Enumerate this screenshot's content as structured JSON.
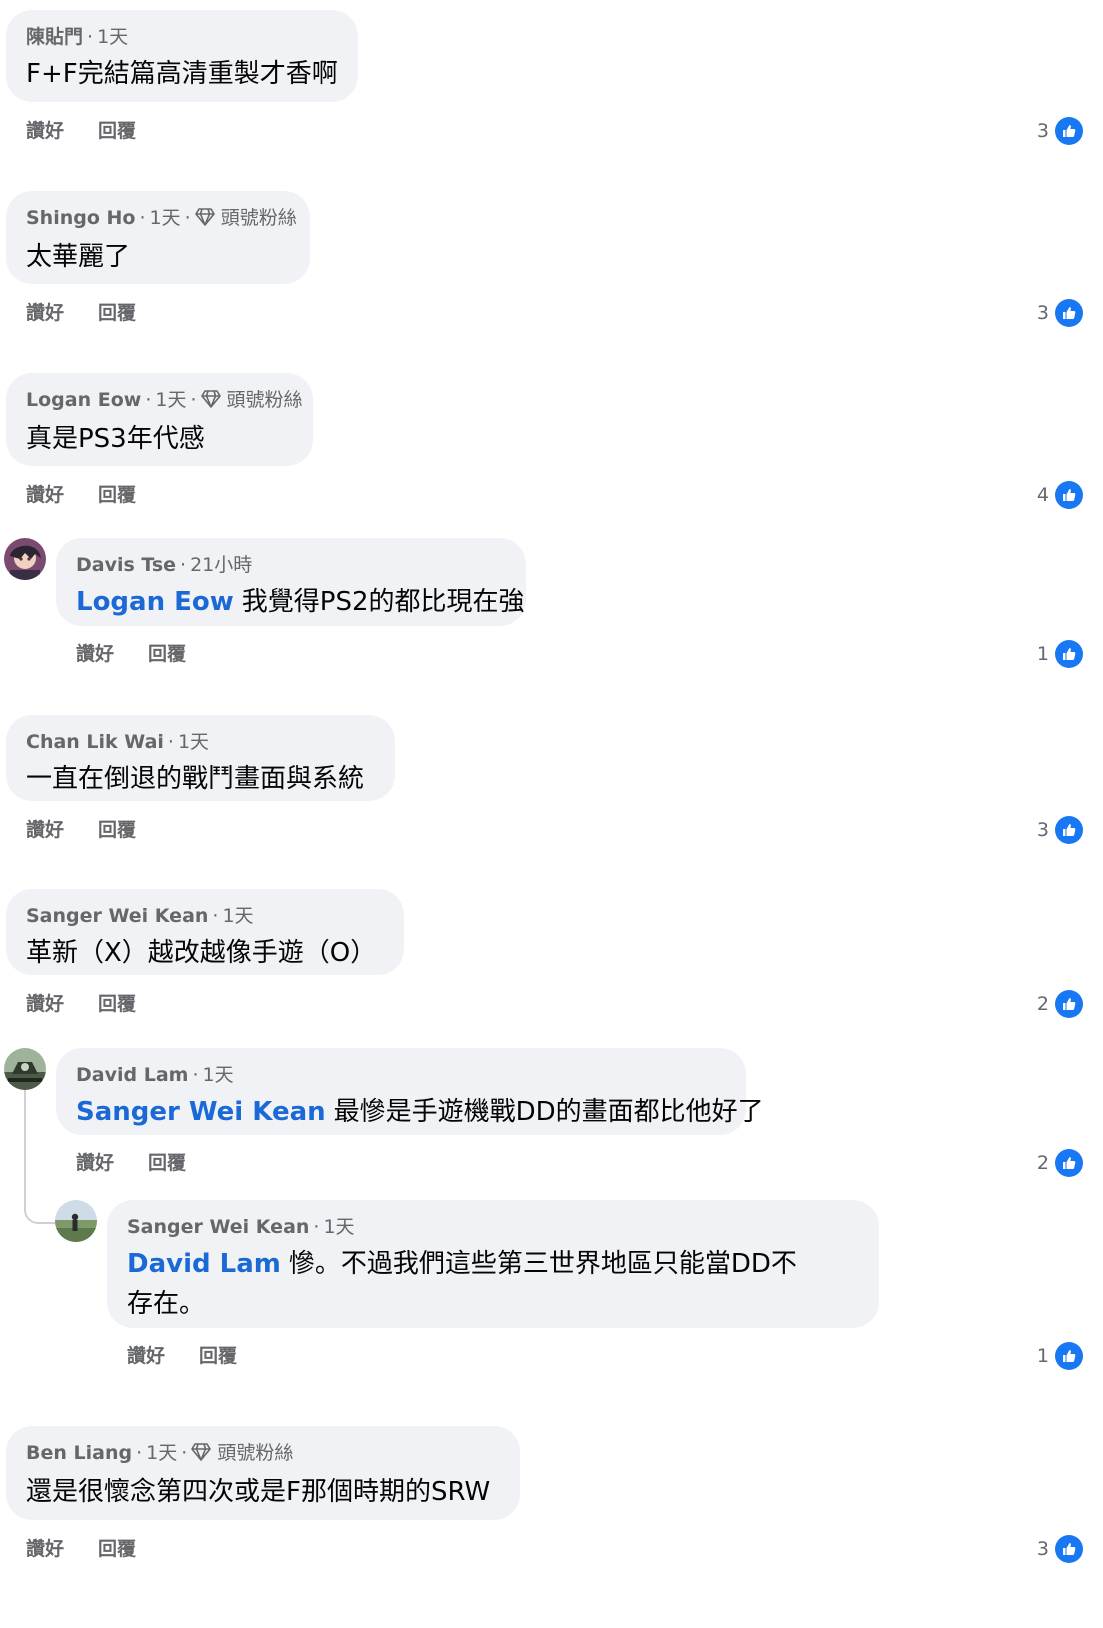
{
  "ui": {
    "like_label": "讚好",
    "reply_label": "回覆",
    "meta_separator": "·"
  },
  "comments": [
    {
      "author": "陳貼門",
      "time": "1天",
      "badge": "",
      "mention": "",
      "text": "F+F完結篇高清重製才香啊",
      "likes": "3"
    },
    {
      "author": "Shingo Ho",
      "time": "1天",
      "badge": "頭號粉絲",
      "mention": "",
      "text": "太華麗了",
      "likes": "3"
    },
    {
      "author": "Logan Eow",
      "time": "1天",
      "badge": "頭號粉絲",
      "mention": "",
      "text": "真是PS3年代感",
      "likes": "4"
    },
    {
      "author": "Davis Tse",
      "time": "21小時",
      "badge": "",
      "mention": "Logan Eow",
      "text": "我覺得PS2的都比現在強",
      "likes": "1"
    },
    {
      "author": "Chan Lik Wai",
      "time": "1天",
      "badge": "",
      "mention": "",
      "text": "一直在倒退的戰鬥畫面與系統",
      "likes": "3"
    },
    {
      "author": "Sanger Wei Kean",
      "time": "1天",
      "badge": "",
      "mention": "",
      "text": "革新（X）越改越像手遊（O）",
      "likes": "2"
    },
    {
      "author": "David Lam",
      "time": "1天",
      "badge": "",
      "mention": "Sanger Wei Kean",
      "text": "最慘是手遊機戰DD的畫面都比他好了",
      "likes": "2"
    },
    {
      "author": "Sanger Wei Kean",
      "time": "1天",
      "badge": "",
      "mention": "David Lam",
      "text": "慘。不過我們這些第三世界地區只能當DD不存在。",
      "likes": "1"
    },
    {
      "author": "Ben Liang",
      "time": "1天",
      "badge": "頭號粉絲",
      "mention": "",
      "text": "還是很懷念第四次或是F那個時期的SRW",
      "likes": "3"
    }
  ],
  "icons": {
    "like": "thumbs-up-icon",
    "badge": "diamond-icon",
    "avatar_davis": "avatar-anime-character",
    "avatar_david": "avatar-mech",
    "avatar_sanger": "avatar-landscape-person"
  },
  "colors": {
    "bubble_bg": "#f0f2f5",
    "mention": "#1b69d6",
    "like_blue": "#1877f2",
    "meta_gray": "#65676b"
  }
}
